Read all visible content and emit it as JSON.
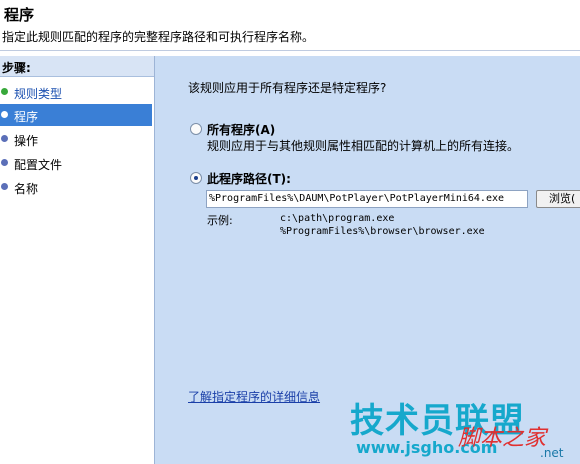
{
  "header": {
    "title": "程序",
    "subtitle": "指定此规则匹配的程序的完整程序路径和可执行程序名称。"
  },
  "sidebar": {
    "title": "步骤:",
    "steps": [
      {
        "label": "规则类型",
        "state": "done"
      },
      {
        "label": "程序",
        "state": "current"
      },
      {
        "label": "操作",
        "state": "pending"
      },
      {
        "label": "配置文件",
        "state": "pending"
      },
      {
        "label": "名称",
        "state": "pending"
      }
    ]
  },
  "main": {
    "question": "该规则应用于所有程序还是特定程序?",
    "all_programs": {
      "title": "所有程序(A)",
      "description": "规则应用于与其他规则属性相匹配的计算机上的所有连接。",
      "checked": false
    },
    "this_program": {
      "title": "此程序路径(T):",
      "checked": true,
      "path_value": "%ProgramFiles%\\DAUM\\PotPlayer\\PotPlayerMini64.exe",
      "browse_label": "浏览(",
      "example_label": "示例:",
      "examples": [
        "c:\\path\\program.exe",
        "%ProgramFiles%\\browser\\browser.exe"
      ]
    },
    "learn_more_link": "了解指定程序的详细信息"
  },
  "watermark": {
    "main_text": "技术员联盟",
    "url_text": "www.jsgho.com",
    "logo_text": "脚本之家",
    "net_text": ".net"
  },
  "colors": {
    "main_bg": "#c9dcf4",
    "selected_step": "#3a7fd6",
    "done_dot": "#38a83a",
    "link": "#1a3fa8",
    "watermark": "#16a8cc"
  }
}
